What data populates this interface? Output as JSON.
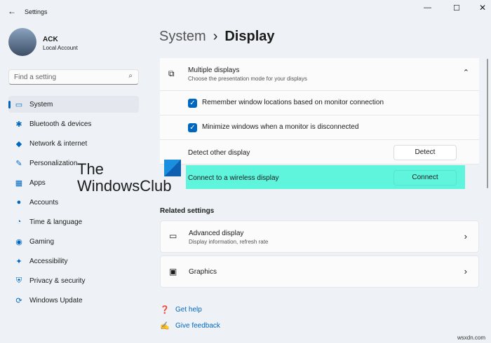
{
  "window": {
    "title": "Settings"
  },
  "user": {
    "name": "ACK",
    "account": "Local Account"
  },
  "search": {
    "placeholder": "Find a setting"
  },
  "sidebar": {
    "items": [
      {
        "label": "System",
        "icon": "▭"
      },
      {
        "label": "Bluetooth & devices",
        "icon": "✱"
      },
      {
        "label": "Network & internet",
        "icon": "◆"
      },
      {
        "label": "Personalization",
        "icon": "✎"
      },
      {
        "label": "Apps",
        "icon": "▦"
      },
      {
        "label": "Accounts",
        "icon": "●"
      },
      {
        "label": "Time & language",
        "icon": "◔"
      },
      {
        "label": "Gaming",
        "icon": "◉"
      },
      {
        "label": "Accessibility",
        "icon": "✦"
      },
      {
        "label": "Privacy & security",
        "icon": "⛨"
      },
      {
        "label": "Windows Update",
        "icon": "⟳"
      }
    ]
  },
  "breadcrumb": {
    "parent": "System",
    "sep": "›",
    "current": "Display"
  },
  "multiple": {
    "title": "Multiple displays",
    "subtitle": "Choose the presentation mode for your displays",
    "remember": "Remember window locations based on monitor connection",
    "minimize": "Minimize windows when a monitor is disconnected",
    "detect_label": "Detect other display",
    "detect_btn": "Detect",
    "wireless_label": "Connect to a wireless display",
    "connect_btn": "Connect"
  },
  "related": {
    "heading": "Related settings",
    "advanced": {
      "title": "Advanced display",
      "subtitle": "Display information, refresh rate"
    },
    "graphics": {
      "title": "Graphics"
    }
  },
  "help": {
    "get_help": "Get help",
    "feedback": "Give feedback"
  },
  "watermark": {
    "line1": "The",
    "line2": "WindowsClub"
  },
  "footer": "wsxdn.com",
  "colors": {
    "accent": "#0067c0",
    "highlight": "#5ef5dc"
  }
}
